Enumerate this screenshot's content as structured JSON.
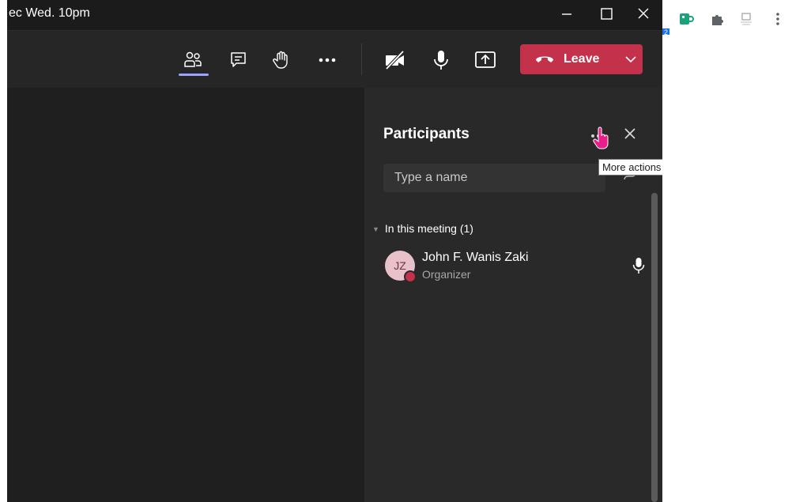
{
  "window": {
    "title": "ec Wed. 10pm"
  },
  "toolbar": {
    "leave_label": "Leave"
  },
  "participants": {
    "title": "Participants",
    "search_placeholder": "Type a name",
    "section_label": "In this meeting (1)",
    "people": [
      {
        "initials": "JZ",
        "name": "John F. Wanis Zaki",
        "role": "Organizer"
      }
    ]
  },
  "tooltip": {
    "text": "More actions"
  },
  "browser": {
    "badge_count": "2"
  },
  "colors": {
    "leave": "#c4314b",
    "accent": "#9ea2ff",
    "panel": "#292929",
    "stage": "#1f1f1f"
  }
}
